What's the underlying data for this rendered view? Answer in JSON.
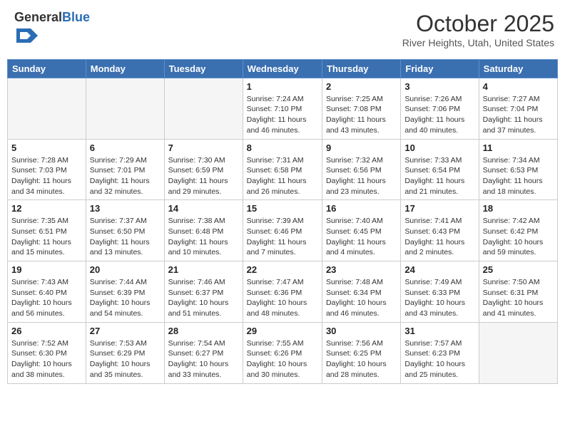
{
  "header": {
    "logo_general": "General",
    "logo_blue": "Blue",
    "month": "October 2025",
    "location": "River Heights, Utah, United States"
  },
  "weekdays": [
    "Sunday",
    "Monday",
    "Tuesday",
    "Wednesday",
    "Thursday",
    "Friday",
    "Saturday"
  ],
  "weeks": [
    [
      {
        "day": "",
        "info": ""
      },
      {
        "day": "",
        "info": ""
      },
      {
        "day": "",
        "info": ""
      },
      {
        "day": "1",
        "info": "Sunrise: 7:24 AM\nSunset: 7:10 PM\nDaylight: 11 hours and 46 minutes."
      },
      {
        "day": "2",
        "info": "Sunrise: 7:25 AM\nSunset: 7:08 PM\nDaylight: 11 hours and 43 minutes."
      },
      {
        "day": "3",
        "info": "Sunrise: 7:26 AM\nSunset: 7:06 PM\nDaylight: 11 hours and 40 minutes."
      },
      {
        "day": "4",
        "info": "Sunrise: 7:27 AM\nSunset: 7:04 PM\nDaylight: 11 hours and 37 minutes."
      }
    ],
    [
      {
        "day": "5",
        "info": "Sunrise: 7:28 AM\nSunset: 7:03 PM\nDaylight: 11 hours and 34 minutes."
      },
      {
        "day": "6",
        "info": "Sunrise: 7:29 AM\nSunset: 7:01 PM\nDaylight: 11 hours and 32 minutes."
      },
      {
        "day": "7",
        "info": "Sunrise: 7:30 AM\nSunset: 6:59 PM\nDaylight: 11 hours and 29 minutes."
      },
      {
        "day": "8",
        "info": "Sunrise: 7:31 AM\nSunset: 6:58 PM\nDaylight: 11 hours and 26 minutes."
      },
      {
        "day": "9",
        "info": "Sunrise: 7:32 AM\nSunset: 6:56 PM\nDaylight: 11 hours and 23 minutes."
      },
      {
        "day": "10",
        "info": "Sunrise: 7:33 AM\nSunset: 6:54 PM\nDaylight: 11 hours and 21 minutes."
      },
      {
        "day": "11",
        "info": "Sunrise: 7:34 AM\nSunset: 6:53 PM\nDaylight: 11 hours and 18 minutes."
      }
    ],
    [
      {
        "day": "12",
        "info": "Sunrise: 7:35 AM\nSunset: 6:51 PM\nDaylight: 11 hours and 15 minutes."
      },
      {
        "day": "13",
        "info": "Sunrise: 7:37 AM\nSunset: 6:50 PM\nDaylight: 11 hours and 13 minutes."
      },
      {
        "day": "14",
        "info": "Sunrise: 7:38 AM\nSunset: 6:48 PM\nDaylight: 11 hours and 10 minutes."
      },
      {
        "day": "15",
        "info": "Sunrise: 7:39 AM\nSunset: 6:46 PM\nDaylight: 11 hours and 7 minutes."
      },
      {
        "day": "16",
        "info": "Sunrise: 7:40 AM\nSunset: 6:45 PM\nDaylight: 11 hours and 4 minutes."
      },
      {
        "day": "17",
        "info": "Sunrise: 7:41 AM\nSunset: 6:43 PM\nDaylight: 11 hours and 2 minutes."
      },
      {
        "day": "18",
        "info": "Sunrise: 7:42 AM\nSunset: 6:42 PM\nDaylight: 10 hours and 59 minutes."
      }
    ],
    [
      {
        "day": "19",
        "info": "Sunrise: 7:43 AM\nSunset: 6:40 PM\nDaylight: 10 hours and 56 minutes."
      },
      {
        "day": "20",
        "info": "Sunrise: 7:44 AM\nSunset: 6:39 PM\nDaylight: 10 hours and 54 minutes."
      },
      {
        "day": "21",
        "info": "Sunrise: 7:46 AM\nSunset: 6:37 PM\nDaylight: 10 hours and 51 minutes."
      },
      {
        "day": "22",
        "info": "Sunrise: 7:47 AM\nSunset: 6:36 PM\nDaylight: 10 hours and 48 minutes."
      },
      {
        "day": "23",
        "info": "Sunrise: 7:48 AM\nSunset: 6:34 PM\nDaylight: 10 hours and 46 minutes."
      },
      {
        "day": "24",
        "info": "Sunrise: 7:49 AM\nSunset: 6:33 PM\nDaylight: 10 hours and 43 minutes."
      },
      {
        "day": "25",
        "info": "Sunrise: 7:50 AM\nSunset: 6:31 PM\nDaylight: 10 hours and 41 minutes."
      }
    ],
    [
      {
        "day": "26",
        "info": "Sunrise: 7:52 AM\nSunset: 6:30 PM\nDaylight: 10 hours and 38 minutes."
      },
      {
        "day": "27",
        "info": "Sunrise: 7:53 AM\nSunset: 6:29 PM\nDaylight: 10 hours and 35 minutes."
      },
      {
        "day": "28",
        "info": "Sunrise: 7:54 AM\nSunset: 6:27 PM\nDaylight: 10 hours and 33 minutes."
      },
      {
        "day": "29",
        "info": "Sunrise: 7:55 AM\nSunset: 6:26 PM\nDaylight: 10 hours and 30 minutes."
      },
      {
        "day": "30",
        "info": "Sunrise: 7:56 AM\nSunset: 6:25 PM\nDaylight: 10 hours and 28 minutes."
      },
      {
        "day": "31",
        "info": "Sunrise: 7:57 AM\nSunset: 6:23 PM\nDaylight: 10 hours and 25 minutes."
      },
      {
        "day": "",
        "info": ""
      }
    ]
  ]
}
